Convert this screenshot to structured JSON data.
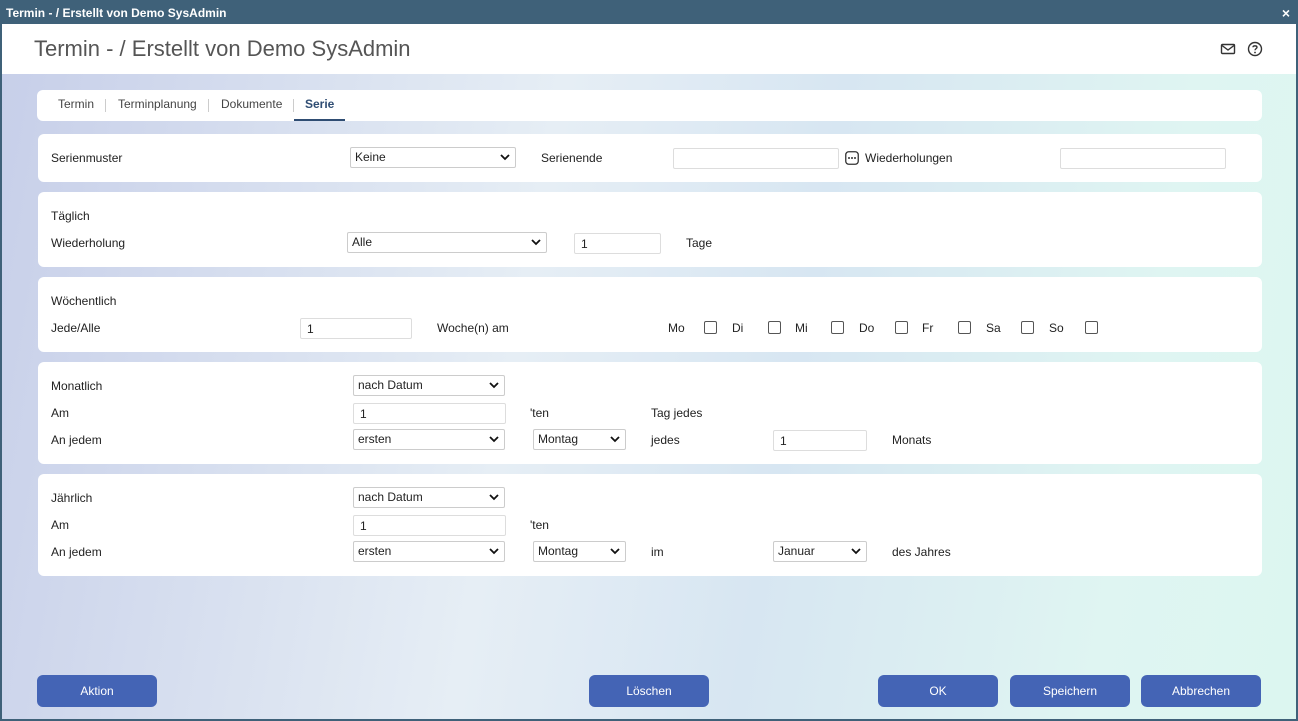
{
  "window": {
    "title": "Termin - / Erstellt von Demo SysAdmin",
    "close_glyph": "×"
  },
  "header": {
    "title": "Termin - / Erstellt von Demo SysAdmin"
  },
  "tabs": [
    {
      "label": "Termin"
    },
    {
      "label": "Terminplanung"
    },
    {
      "label": "Dokumente"
    },
    {
      "label": "Serie"
    }
  ],
  "active_tab": "Serie",
  "series": {
    "pattern_label": "Serienmuster",
    "pattern_value": "Keine",
    "end_label": "Serienende",
    "end_value": "",
    "repetitions_label": "Wiederholungen",
    "repetitions_value": ""
  },
  "daily": {
    "title": "Täglich",
    "repeat_label": "Wiederholung",
    "repeat_value": "Alle",
    "count_value": "1",
    "unit_label": "Tage"
  },
  "weekly": {
    "title": "Wöchentlich",
    "every_label": "Jede/Alle",
    "every_value": "1",
    "weeks_label": "Woche(n) am",
    "days": [
      {
        "label": "Mo",
        "checked": false
      },
      {
        "label": "Di",
        "checked": false
      },
      {
        "label": "Mi",
        "checked": false
      },
      {
        "label": "Do",
        "checked": false
      },
      {
        "label": "Fr",
        "checked": false
      },
      {
        "label": "Sa",
        "checked": false
      },
      {
        "label": "So",
        "checked": false
      }
    ]
  },
  "monthly": {
    "title": "Monatlich",
    "mode_value": "nach Datum",
    "on_label": "Am",
    "day_value": "1",
    "ten_suffix": "'ten",
    "day_every_label": "Tag jedes",
    "on_each_label": "An jedem",
    "ordinal_value": "ersten",
    "weekday_value": "Montag",
    "every_label": "jedes",
    "months_value": "1",
    "months_label": "Monats"
  },
  "yearly": {
    "title": "Jährlich",
    "mode_value": "nach Datum",
    "on_label": "Am",
    "day_value": "1",
    "ten_suffix": "'ten",
    "on_each_label": "An jedem",
    "ordinal_value": "ersten",
    "weekday_value": "Montag",
    "in_label": "im",
    "month_value": "Januar",
    "year_label": "des Jahres"
  },
  "buttons": {
    "action": "Aktion",
    "delete": "Löschen",
    "ok": "OK",
    "save": "Speichern",
    "cancel": "Abbrechen"
  },
  "icons": {
    "close": "close-icon",
    "mail": "mail-icon",
    "help": "help-icon",
    "chevron": "chevron-down-icon",
    "picker": "more-options-icon"
  },
  "colors": {
    "titlebar": "#3f6179",
    "button": "#4464b5",
    "active_tab": "#2f4d73"
  }
}
